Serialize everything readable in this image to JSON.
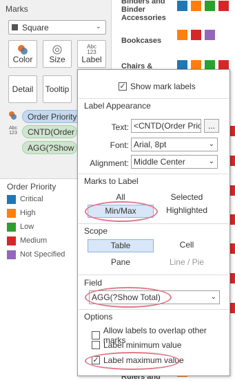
{
  "marks": {
    "title": "Marks",
    "mark_type": "Square",
    "buttons": {
      "color": "Color",
      "size": "Size",
      "label": "Label",
      "detail": "Detail",
      "tooltip": "Tooltip",
      "label_icon": "Abc 123"
    },
    "pills": [
      {
        "text": "Order Priority",
        "icon": "color-icon"
      },
      {
        "text": "CNTD(Order P",
        "icon_top": "Abc",
        "icon_bottom": "123"
      },
      {
        "text": "AGG(?Show To"
      }
    ]
  },
  "legend": {
    "title": "Order Priority",
    "items": [
      {
        "label": "Critical",
        "color": "#1f77b4"
      },
      {
        "label": "High",
        "color": "#ff7f0e"
      },
      {
        "label": "Low",
        "color": "#2ca02c"
      },
      {
        "label": "Medium",
        "color": "#d62728"
      },
      {
        "label": "Not Specified",
        "color": "#9467bd"
      }
    ]
  },
  "view": {
    "categories": [
      "Binders and\nBinder\nAccessories",
      "Bookcases",
      "Chairs &",
      "Rulers and"
    ]
  },
  "dialog": {
    "show_mark_labels": "Show mark labels",
    "label_appearance": "Label Appearance",
    "text_label": "Text:",
    "text_value": "<CNTD(Order Prior",
    "ellipsis": "...",
    "font_label": "Font:",
    "font_value": "Arial, 8pt",
    "alignment_label": "Alignment:",
    "alignment_value": "Middle Center",
    "marks_to_label": "Marks to Label",
    "mtl_all": "All",
    "mtl_selected": "Selected",
    "mtl_minmax": "Min/Max",
    "mtl_highlighted": "Highlighted",
    "scope": "Scope",
    "scope_table": "Table",
    "scope_cell": "Cell",
    "scope_pane": "Pane",
    "scope_linepie": "Line / Pie",
    "field": "Field",
    "field_value": "AGG(?Show Total)",
    "options": "Options",
    "opt_overlap": "Allow labels to overlap other marks",
    "opt_min": "Label minimum value",
    "opt_max": "Label maximum value"
  }
}
